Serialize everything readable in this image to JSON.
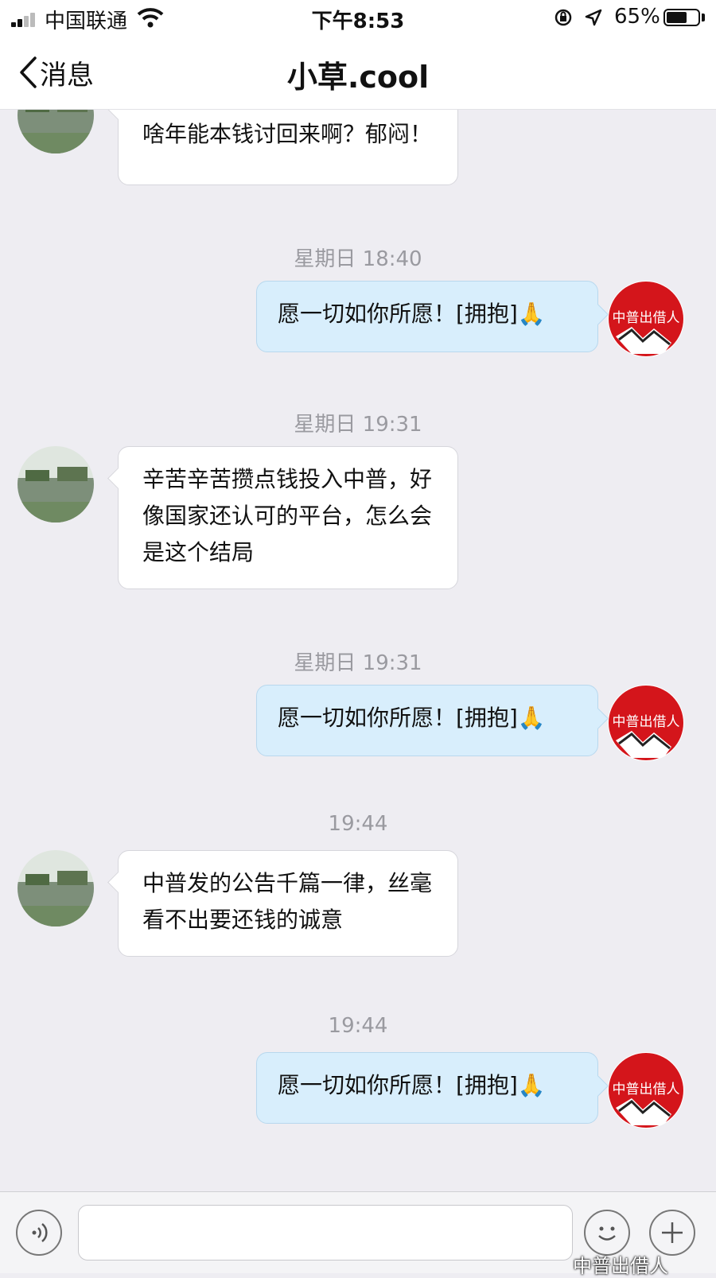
{
  "status_bar": {
    "carrier": "中国联通",
    "time": "下午8:53",
    "battery_percent": "65%",
    "battery_level": 0.65
  },
  "nav": {
    "back_label": "消息",
    "title": "小草.cool"
  },
  "messages": [
    {
      "side": "in",
      "text": "啥年能本钱讨回来啊？郁闷！"
    },
    {
      "type": "timestamp",
      "text": "星期日 18:40"
    },
    {
      "side": "out",
      "text": "愿一切如你所愿！[拥抱]🙏"
    },
    {
      "type": "timestamp",
      "text": "星期日 19:31"
    },
    {
      "side": "in",
      "text": "辛苦辛苦攒点钱投入中普，好像国家还认可的平台，怎么会是这个结局"
    },
    {
      "type": "timestamp",
      "text": "星期日 19:31"
    },
    {
      "side": "out",
      "text": "愿一切如你所愿！[拥抱]🙏"
    },
    {
      "type": "timestamp",
      "text": "19:44"
    },
    {
      "side": "in",
      "text": "中普发的公告千篇一律，丝毫看不出要还钱的诚意"
    },
    {
      "type": "timestamp",
      "text": "19:44"
    },
    {
      "side": "out",
      "text": "愿一切如你所愿！[拥抱]🙏"
    }
  ],
  "avatars": {
    "self_logo_text": "中普出借人"
  },
  "input": {
    "value": "",
    "placeholder": ""
  },
  "watermark": "中普出借人",
  "icons": [
    "signal-icon",
    "wifi-icon",
    "orientation-lock-icon",
    "location-icon",
    "battery-icon",
    "back-chevron-icon",
    "voice-icon",
    "emoji-icon",
    "plus-icon"
  ]
}
